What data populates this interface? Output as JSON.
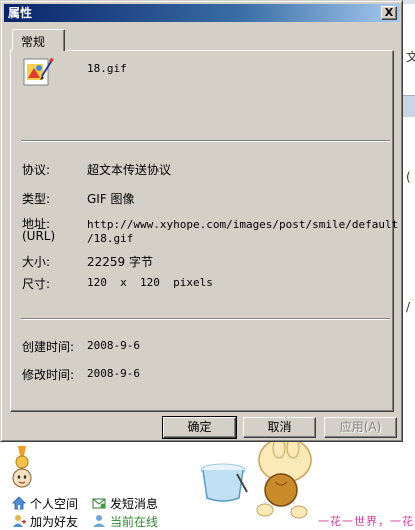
{
  "dialog": {
    "title": "属性",
    "close_glyph": "X",
    "tab_label": "常规",
    "file_name": "18.gif",
    "properties": {
      "protocol_label": "协议:",
      "protocol_value": "超文本传送协议",
      "type_label": "类型:",
      "type_value": "GIF 图像",
      "address_label": "地址:",
      "address_label_sub": "(URL)",
      "address_line1": "http://www.xyhope.com/images/post/smile/default",
      "address_line2": "/18.gif",
      "size_label": "大小:",
      "size_value": "22259 字节",
      "dimensions_label": "尺寸:",
      "dimensions_value": "120  x  120  pixels",
      "created_label": "创建时间:",
      "created_value": "2008-9-6",
      "modified_label": "修改时间:",
      "modified_value": "2008-9-6"
    },
    "buttons": {
      "ok": "确定",
      "cancel": "取消",
      "apply": "应用(A)"
    }
  },
  "background": {
    "right_chars": [
      "文",
      "(",
      "/"
    ],
    "links": {
      "personal_space": "个人空间",
      "send_message": "发短消息",
      "add_friend": "加为好友",
      "online_status": "当前在线"
    },
    "slogan": "一花一世界，一花"
  },
  "icons": {
    "file": "gif-image-file-icon",
    "home": "home-icon",
    "message": "message-icon",
    "add_friend": "add-friend-icon",
    "online": "online-user-icon"
  },
  "colors": {
    "title_start": "#0a246a",
    "title_end": "#a6caf0",
    "dialog_face": "#d4d0c8",
    "online_text": "#2d8a2d",
    "slogan": "#d63c9a"
  }
}
